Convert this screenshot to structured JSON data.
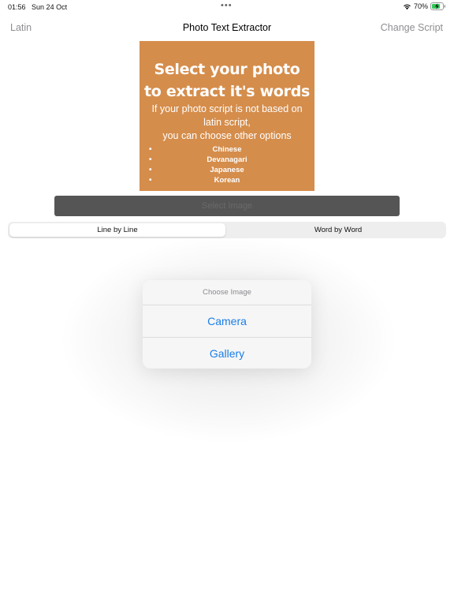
{
  "status": {
    "time": "01:56",
    "date": "Sun 24 Oct",
    "dots": "•••",
    "battery": "70%",
    "icons": [
      "wifi-icon",
      "battery-charging-icon"
    ]
  },
  "nav": {
    "left": "Latin",
    "title": "Photo Text Extractor",
    "right": "Change Script"
  },
  "hero": {
    "title_line1": "Select your photo",
    "title_line2": "to extract it's words",
    "sub_line1": "If your photo script is not based on",
    "sub_line2": "latin script,",
    "sub_line3": "you can choose other options",
    "options": [
      "Chinese",
      "Devanagari",
      "Japanese",
      "Korean"
    ],
    "background": "#d58d4b"
  },
  "select_button": {
    "label": "Select Image"
  },
  "segments": {
    "line": "Line by Line",
    "word": "Word by Word",
    "selected": "Line by Line"
  },
  "popover": {
    "header": "Choose Image",
    "items": [
      "Camera",
      "Gallery"
    ],
    "accent": "#1a7ee6"
  }
}
